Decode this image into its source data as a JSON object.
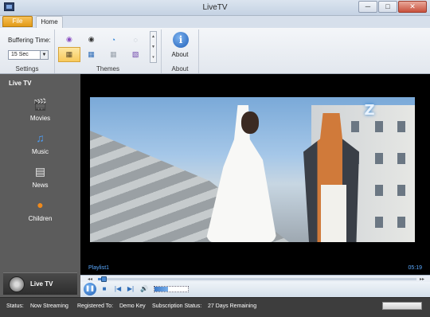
{
  "window": {
    "title": "LiveTV",
    "minimize": "─",
    "maximize": "□",
    "close": "✕"
  },
  "ribbon": {
    "tabs": {
      "file": "File",
      "home": "Home"
    },
    "settings": {
      "buffering_label": "Buffering Time:",
      "buffering_value": "15 Sec",
      "group_label": "Settings"
    },
    "themes": {
      "group_label": "Themes",
      "items": [
        {
          "icon": "purple-orb-theme-icon",
          "glyph": "◉",
          "color": "#8a4fc2"
        },
        {
          "icon": "dark-orb-theme-icon",
          "glyph": "◉",
          "color": "#333333"
        },
        {
          "icon": "blue-orb-theme-icon",
          "glyph": "◔",
          "color": "#1e7ad6"
        },
        {
          "icon": "gray-orb-theme-icon",
          "glyph": "◌",
          "color": "#8a95a6"
        },
        {
          "icon": "grid-dark-theme-icon",
          "glyph": "▦",
          "color": "#5a4a2a"
        },
        {
          "icon": "grid-blue-theme-icon",
          "glyph": "▦",
          "color": "#2f6db8"
        },
        {
          "icon": "grid-gray-theme-icon",
          "glyph": "▦",
          "color": "#9aa3ad"
        },
        {
          "icon": "picture-theme-icon",
          "glyph": "▧",
          "color": "#6a3fa8"
        }
      ],
      "selected_index": 4
    },
    "about": {
      "label": "About",
      "group_label": "About",
      "glyph": "i"
    }
  },
  "sidebar": {
    "title": "Live TV",
    "items": [
      {
        "label": "Movies",
        "icon": "film-clapper-icon",
        "glyph": "🎬"
      },
      {
        "label": "Music",
        "icon": "music-note-icon",
        "glyph": "♫"
      },
      {
        "label": "News",
        "icon": "newspaper-icon",
        "glyph": "▤"
      },
      {
        "label": "Children",
        "icon": "pumpkin-icon",
        "glyph": "●"
      }
    ],
    "footer_label": "Live TV"
  },
  "player": {
    "channel_logo": "Z",
    "playlist_name": "Playlist1",
    "time": "05:19",
    "seek_progress": 0.01,
    "volume_level": 0.4,
    "controls": {
      "play_pause": "❚❚",
      "stop": "■",
      "previous": "|◀",
      "next": "▶|",
      "volume": "🔊"
    }
  },
  "status": {
    "status_label": "Status:",
    "status_value": "Now Streaming",
    "registered_label": "Registered To:",
    "registered_value": "Demo Key",
    "subscription_label": "Subscription Status:",
    "subscription_value": "27 Days Remaining"
  }
}
